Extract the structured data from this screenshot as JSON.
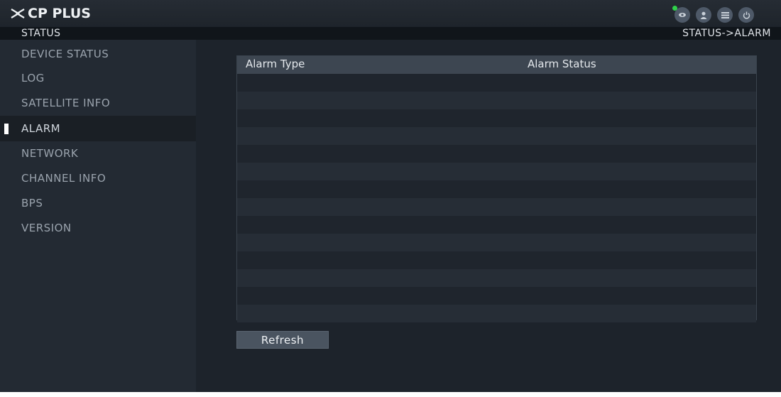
{
  "app": {
    "brand": "CP PLUS",
    "section_title": "STATUS",
    "breadcrumb": "STATUS->ALARM"
  },
  "top_icons": [
    "camera-icon",
    "user-icon",
    "menu-icon",
    "power-icon"
  ],
  "sidebar": {
    "items": [
      {
        "label": "DEVICE STATUS",
        "active": false
      },
      {
        "label": "LOG",
        "active": false
      },
      {
        "label": "SATELLITE INFO",
        "active": false
      },
      {
        "label": "ALARM",
        "active": true
      },
      {
        "label": "NETWORK",
        "active": false
      },
      {
        "label": "CHANNEL INFO",
        "active": false
      },
      {
        "label": "BPS",
        "active": false
      },
      {
        "label": "VERSION",
        "active": false
      }
    ]
  },
  "alarm_table": {
    "columns": [
      "Alarm Type",
      "Alarm Status"
    ],
    "rows": []
  },
  "actions": {
    "refresh_label": "Refresh"
  },
  "colors": {
    "background": "#1d232b",
    "sidebar": "#232a33",
    "header_row": "#3d4651",
    "status_indicator": "#2fd24a"
  }
}
